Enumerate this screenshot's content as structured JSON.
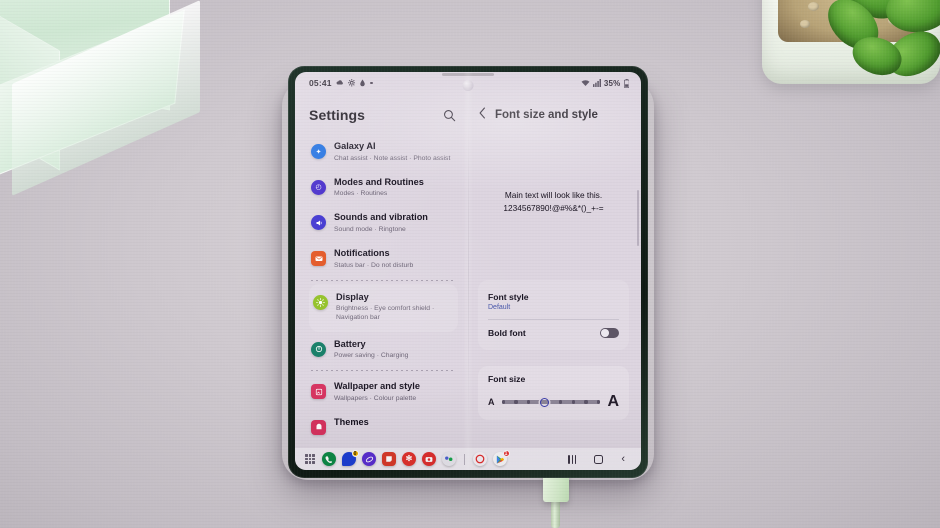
{
  "scene": {
    "description": "Samsung Galaxy Z Fold unfolded on a desk showing Settings with Font size and style",
    "objects": [
      "glass-ornament",
      "potted-succulent",
      "charging-cable"
    ]
  },
  "status_bar": {
    "time": "05:41",
    "left_icons": [
      "weather-icon",
      "gear-icon",
      "drop-icon",
      "dot-icon"
    ],
    "wifi_icon": "wifi-icon",
    "signal_icon": "signal-icon",
    "battery_text": "35%",
    "battery_icon": "battery-icon"
  },
  "left_pane": {
    "title": "Settings",
    "search_icon": "search-icon",
    "items": [
      {
        "label": "Galaxy AI",
        "sub": "Chat assist  ·  Note assist  ·  Photo assist",
        "icon": "galaxy-ai-icon",
        "color": "#1f6fe0",
        "glyph": "✦",
        "card": false
      },
      {
        "label": "Modes and Routines",
        "sub": "Modes  ·  Routines",
        "icon": "modes-routines-icon",
        "color": "#4126c9",
        "glyph": "◴",
        "card": false
      },
      {
        "label": "Sounds and vibration",
        "sub": "Sound mode  ·  Ringtone",
        "icon": "sound-icon",
        "color": "#3b2fcf",
        "glyph": "🔊",
        "card": false
      },
      {
        "label": "Notifications",
        "sub": "Status bar  ·  Do not disturb",
        "icon": "notifications-icon",
        "color": "#e2511e",
        "glyph": "✉",
        "card": false
      },
      {
        "label": "Display",
        "sub": "Brightness  ·  Eye comfort shield  ·  Navigation bar",
        "icon": "display-icon",
        "color": "#8fbf1f",
        "glyph": "☀",
        "card": true
      },
      {
        "label": "Battery",
        "sub": "Power saving  ·  Charging",
        "icon": "battery-settings-icon",
        "color": "#0f7a63",
        "glyph": "◉",
        "card": false
      },
      {
        "label": "Wallpaper and style",
        "sub": "Wallpapers  ·  Colour palette",
        "icon": "wallpaper-icon",
        "color": "#d6315e",
        "glyph": "🖼",
        "card": false
      },
      {
        "label": "Themes",
        "sub": "",
        "icon": "themes-icon",
        "color": "#d6315e",
        "glyph": "◍",
        "card": false
      }
    ]
  },
  "right_pane": {
    "back_icon": "back-chevron-icon",
    "title": "Font size and style",
    "preview_line1": "Main text will look like this.",
    "preview_line2": "1234567890!@#%&*()_+-=",
    "font_style": {
      "label": "Font style",
      "value": "Default"
    },
    "bold_font": {
      "label": "Bold font",
      "enabled": false
    },
    "font_size": {
      "label": "Font size",
      "small_label": "A",
      "large_label": "A",
      "steps": 8,
      "current_step": 4
    }
  },
  "taskbar": {
    "apps_icon": "app-drawer-icon",
    "apps": [
      {
        "name": "phone-icon",
        "glyph": "◖",
        "color": "#0e8a47",
        "shape": "circle",
        "badge": ""
      },
      {
        "name": "messages-icon",
        "glyph": "",
        "color": "#1d3fd4",
        "shape": "circle",
        "badge": "0"
      },
      {
        "name": "samsung-internet-icon",
        "glyph": "◎",
        "color": "#5b2fd1",
        "shape": "circle",
        "badge": ""
      },
      {
        "name": "samsung-notes-icon",
        "glyph": "▱",
        "color": "#d83a2a",
        "shape": "circle",
        "badge": ""
      },
      {
        "name": "gallery-icon",
        "glyph": "✻",
        "color": "#e0322e",
        "shape": "circle",
        "badge": ""
      },
      {
        "name": "camera-icon",
        "glyph": "▣",
        "color": "#de2f2f",
        "shape": "circle",
        "badge": ""
      },
      {
        "name": "contacts-icon",
        "glyph": "⚇",
        "color": "#dcdce4",
        "shape": "circle",
        "badge": ""
      }
    ],
    "recent_apps": [
      {
        "name": "clock-icon",
        "glyph": "◯",
        "color": "#e02b2b",
        "shape": "circle",
        "badge": ""
      },
      {
        "name": "play-store-icon",
        "glyph": "▶",
        "color": "#f2f2f4",
        "shape": "circle",
        "badge": "1"
      }
    ],
    "nav": {
      "recents": "recents-button",
      "home": "home-button",
      "back": "back-button",
      "back_glyph": "‹"
    }
  }
}
